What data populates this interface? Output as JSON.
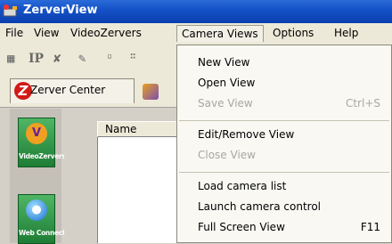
{
  "window": {
    "title": "ZerverView",
    "app_icon": "zerverview-logo-icon"
  },
  "menubar": {
    "items": [
      {
        "label": "File"
      },
      {
        "label": "View"
      },
      {
        "label": "VideoZervers"
      },
      {
        "label": "Camera Views"
      },
      {
        "label": "Options"
      },
      {
        "label": "Help"
      }
    ],
    "active": "Camera Views"
  },
  "toolbar": {
    "icons": [
      "properties-icon",
      "ip-icon",
      "tools-icon",
      "pencil-icon",
      "grid-icon-1",
      "grid-icon-2"
    ],
    "ip_label": "IP"
  },
  "tabs": [
    {
      "label": "Zerver Center",
      "icon": "zerver-logo-icon",
      "selected": true
    },
    {
      "label": "",
      "icon": "camera-tab-icon",
      "selected": false
    }
  ],
  "sidebar": {
    "buttons": [
      {
        "label": "VideoZervers",
        "icon": "videozervers-icon"
      },
      {
        "label": "Web Connect",
        "icon": "globe-icon"
      }
    ]
  },
  "list": {
    "column_header": "Name"
  },
  "camera_views_menu": {
    "groups": [
      [
        {
          "label": "New View",
          "shortcut": "",
          "enabled": true
        },
        {
          "label": "Open View",
          "shortcut": "",
          "enabled": true
        },
        {
          "label": "Save View",
          "shortcut": "Ctrl+S",
          "enabled": false
        }
      ],
      [
        {
          "label": "Edit/Remove View",
          "shortcut": "",
          "enabled": true
        },
        {
          "label": "Close View",
          "shortcut": "",
          "enabled": false
        }
      ],
      [
        {
          "label": "Load camera list",
          "shortcut": "",
          "enabled": true
        },
        {
          "label": "Launch camera control",
          "shortcut": "",
          "enabled": true
        },
        {
          "label": "Full Screen View",
          "shortcut": "F11",
          "enabled": true
        }
      ]
    ]
  },
  "colors": {
    "titlebar": "#0b3fae",
    "menu_background": "#f9f8f3",
    "disabled_text": "#a8a7a0",
    "sidebar_button": "#1e7d35",
    "zerver_logo": "#d21a16"
  }
}
